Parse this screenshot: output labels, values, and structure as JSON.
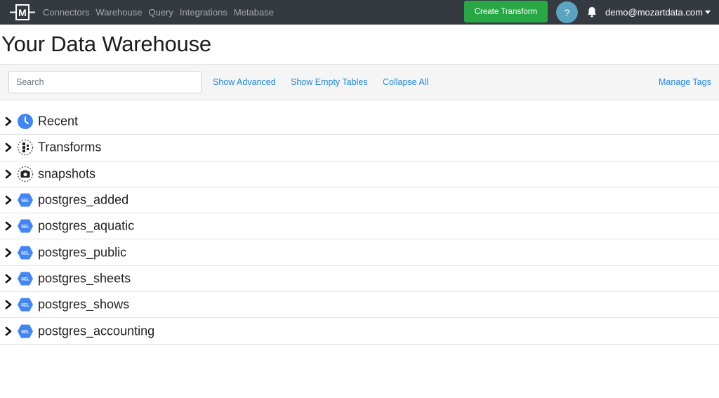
{
  "navbar": {
    "logo_text": "M",
    "links": [
      "Connectors",
      "Warehouse",
      "Query",
      "Integrations",
      "Metabase"
    ],
    "create_button": "Create Transform",
    "help_label": "?",
    "user_email": "demo@mozartdata.com",
    "colors": {
      "background": "#343a40",
      "create": "#28a745",
      "help": "#5ba4c0"
    }
  },
  "page": {
    "title": "Your Data Warehouse"
  },
  "toolbar": {
    "search_placeholder": "Search",
    "show_advanced": "Show Advanced",
    "show_empty_tables": "Show Empty Tables",
    "collapse_all": "Collapse All",
    "manage_tags": "Manage Tags",
    "link_color": "#1e88e5"
  },
  "tree": {
    "rows": [
      {
        "label": "Recent",
        "icon": "clock-icon"
      },
      {
        "label": "Transforms",
        "icon": "transform-icon"
      },
      {
        "label": "snapshots",
        "icon": "camera-icon"
      },
      {
        "label": "postgres_added",
        "icon": "sel-schema-icon"
      },
      {
        "label": "postgres_aquatic",
        "icon": "sel-schema-icon"
      },
      {
        "label": "postgres_public",
        "icon": "sel-schema-icon"
      },
      {
        "label": "postgres_sheets",
        "icon": "sel-schema-icon"
      },
      {
        "label": "postgres_shows",
        "icon": "sel-schema-icon"
      },
      {
        "label": "postgres_accounting",
        "icon": "sel-schema-icon"
      }
    ],
    "sel_badge_text": "SEL",
    "icon_color": "#4285f4"
  }
}
